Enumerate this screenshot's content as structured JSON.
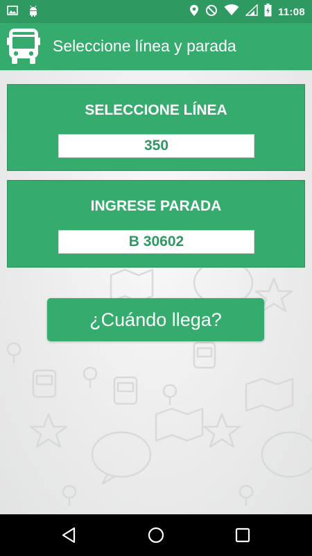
{
  "status_bar": {
    "time": "11:08",
    "icons": [
      "image-icon",
      "android-icon",
      "location-icon",
      "do-not-disturb-icon",
      "wifi-icon",
      "signal-icon",
      "battery-charging-icon"
    ]
  },
  "app_bar": {
    "icon": "bus-icon",
    "title": "Seleccione línea y parada"
  },
  "line_card": {
    "title": "SELECCIONE LÍNEA",
    "value": "350"
  },
  "stop_card": {
    "title": "INGRESE PARADA",
    "value": "B 30602"
  },
  "action_button": {
    "label": "¿Cuándo llega?"
  },
  "nav_bar": {
    "icons": [
      "back-icon",
      "home-icon",
      "recents-icon"
    ]
  },
  "colors": {
    "status_bar": "#2e9a61",
    "primary": "#35ac6e",
    "input_text": "#2e9a61",
    "nav_bar": "#000000"
  }
}
